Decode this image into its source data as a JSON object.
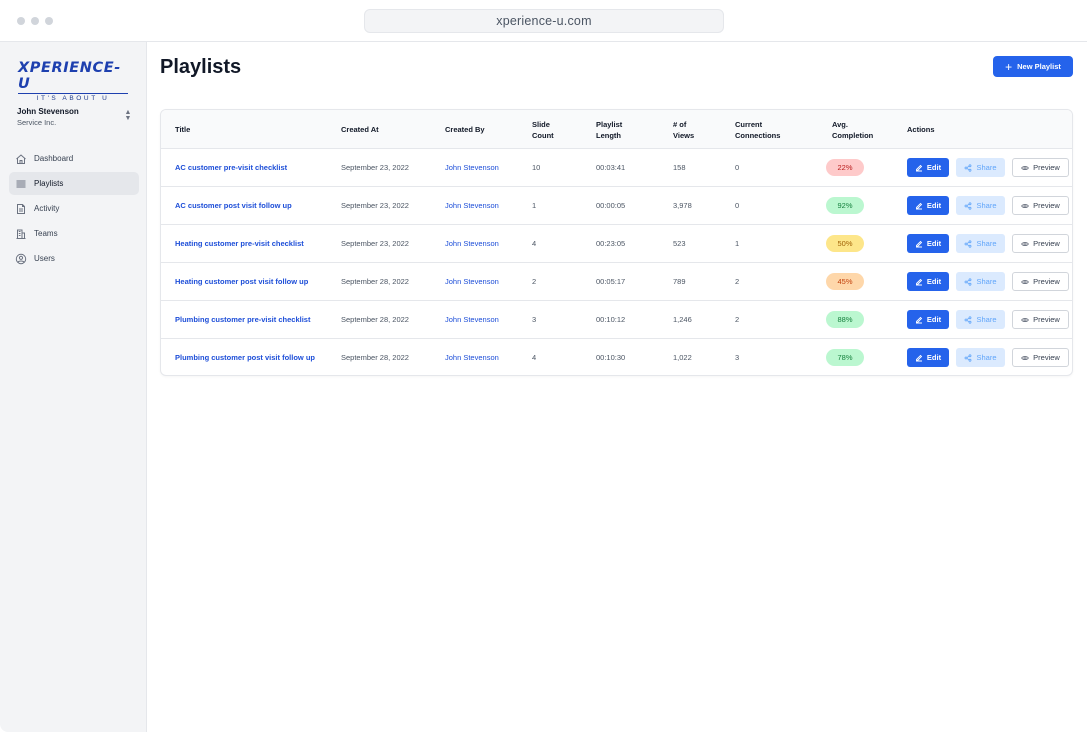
{
  "browser": {
    "url": "xperience-u.com"
  },
  "logo": {
    "main": "XPERIENCE-U",
    "tagline": "IT'S ABOUT U"
  },
  "user": {
    "name": "John Stevenson",
    "org": "Service Inc."
  },
  "nav": [
    {
      "label": "Dashboard",
      "icon": "home-icon"
    },
    {
      "label": "Playlists",
      "icon": "list-icon",
      "active": true
    },
    {
      "label": "Activity",
      "icon": "document-icon"
    },
    {
      "label": "Teams",
      "icon": "building-icon"
    },
    {
      "label": "Users",
      "icon": "user-circle-icon"
    }
  ],
  "page": {
    "title": "Playlists",
    "new_button": "New Playlist"
  },
  "table": {
    "headers": {
      "title": "Title",
      "created_at": "Created At",
      "created_by": "Created By",
      "slide_count_1": "Slide",
      "slide_count_2": "Count",
      "length_1": "Playlist",
      "length_2": "Length",
      "views_1": "# of",
      "views_2": "Views",
      "connections_1": "Current",
      "connections_2": "Connections",
      "completion_1": "Avg.",
      "completion_2": "Completion",
      "actions": "Actions"
    },
    "rows": [
      {
        "title": "AC customer pre-visit checklist",
        "created_at": "September 23, 2022",
        "created_by": "John Stevenson",
        "slides": "10",
        "length": "00:03:41",
        "views": "158",
        "connections": "0",
        "completion": "22%"
      },
      {
        "title": "AC customer post visit follow up",
        "created_at": "September 23, 2022",
        "created_by": "John Stevenson",
        "slides": "1",
        "length": "00:00:05",
        "views": "3,978",
        "connections": "0",
        "completion": "92%"
      },
      {
        "title": "Heating customer pre-visit checklist",
        "created_at": "September 23, 2022",
        "created_by": "John Stevenson",
        "slides": "4",
        "length": "00:23:05",
        "views": "523",
        "connections": "1",
        "completion": "50%"
      },
      {
        "title": "Heating customer post visit follow up",
        "created_at": "September 28, 2022",
        "created_by": "John Stevenson",
        "slides": "2",
        "length": "00:05:17",
        "views": "789",
        "connections": "2",
        "completion": "45%"
      },
      {
        "title": "Plumbing customer pre-visit checklist",
        "created_at": "September 28, 2022",
        "created_by": "John Stevenson",
        "slides": "3",
        "length": "00:10:12",
        "views": "1,246",
        "connections": "2",
        "completion": "88%"
      },
      {
        "title": "Plumbing customer post visit follow up",
        "created_at": "September 28, 2022",
        "created_by": "John Stevenson",
        "slides": "4",
        "length": "00:10:30",
        "views": "1,022",
        "connections": "3",
        "completion": "78%"
      }
    ],
    "actions": {
      "edit": "Edit",
      "share": "Share",
      "preview": "Preview"
    }
  },
  "colors": {
    "primary": "#2563eb",
    "pill_red": {
      "bg": "#fecaca",
      "fg": "#b91c1c"
    },
    "pill_green": {
      "bg": "#bbf7d0",
      "fg": "#15803d"
    },
    "pill_yellow": {
      "bg": "#fde68a",
      "fg": "#a16207"
    },
    "pill_orange": {
      "bg": "#fed7aa",
      "fg": "#c2410c"
    }
  }
}
